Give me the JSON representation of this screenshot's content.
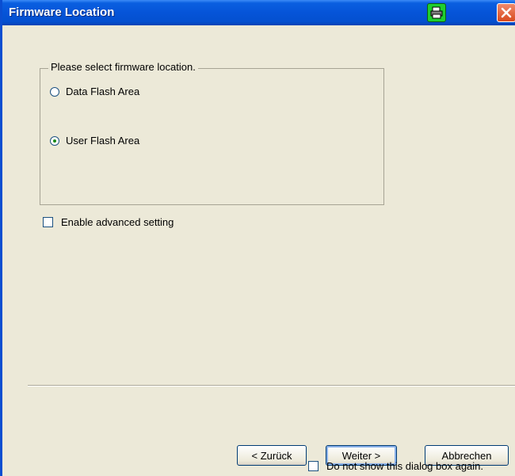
{
  "window": {
    "title": "Firmware Location"
  },
  "icons": {
    "printer": "printer-icon",
    "close": "close-icon"
  },
  "group": {
    "legend": "Please select firmware location.",
    "options": [
      {
        "label": "Data Flash Area",
        "selected": false
      },
      {
        "label": "User Flash Area",
        "selected": true
      }
    ]
  },
  "advanced": {
    "label": "Enable advanced setting",
    "checked": false
  },
  "buttons": {
    "back": "< Zurück",
    "next": "Weiter >",
    "cancel": "Abbrechen"
  },
  "footer": {
    "dont_show_label": "Do not show this dialog box again.",
    "checked": false
  },
  "colors": {
    "titlebar": "#0554d8",
    "dialog_bg": "#ece9d8",
    "close_button": "#d8491d",
    "printer_button": "#1fcf2f"
  }
}
